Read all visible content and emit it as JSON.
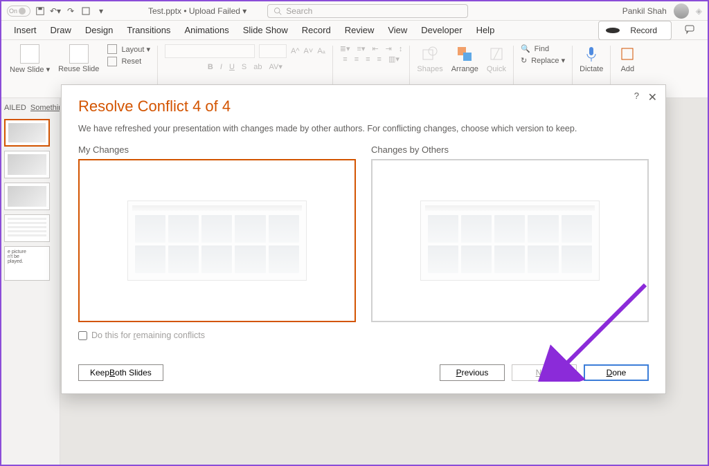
{
  "titlebar": {
    "autosave": "On",
    "filename": "Test.pptx • Upload Failed ▾",
    "search_placeholder": "Search",
    "user_name": "Pankil Shah"
  },
  "menu": {
    "items": [
      "Insert",
      "Draw",
      "Design",
      "Transitions",
      "Animations",
      "Slide Show",
      "Record",
      "Review",
      "View",
      "Developer",
      "Help"
    ],
    "record": "Record"
  },
  "ribbon": {
    "new_slide": "New Slide ▾",
    "reuse_slides": "Reuse Slide",
    "layout": "Layout ▾",
    "reset": "Reset",
    "shapes": "Shapes",
    "arrange": "Arrange",
    "quick": "Quick",
    "find": "Find",
    "replace": "Replace ▾",
    "dictate": "Dictate",
    "add": "Add"
  },
  "upload_banner": {
    "prefix": "AILED",
    "link": "Somethin"
  },
  "slides": {
    "errorText": "e picture\nn't be\nplayed."
  },
  "dialog": {
    "title": "Resolve Conflict 4 of 4",
    "subtitle": "We have refreshed your presentation with changes made by other authors. For conflicting changes, choose which version to keep.",
    "my_changes": "My Changes",
    "others_changes": "Changes by Others",
    "do_remaining": "Do this for remaining conflicts",
    "keep_both": "Keep Both Slides",
    "previous": "Previous",
    "next": "Next",
    "done": "Done"
  }
}
